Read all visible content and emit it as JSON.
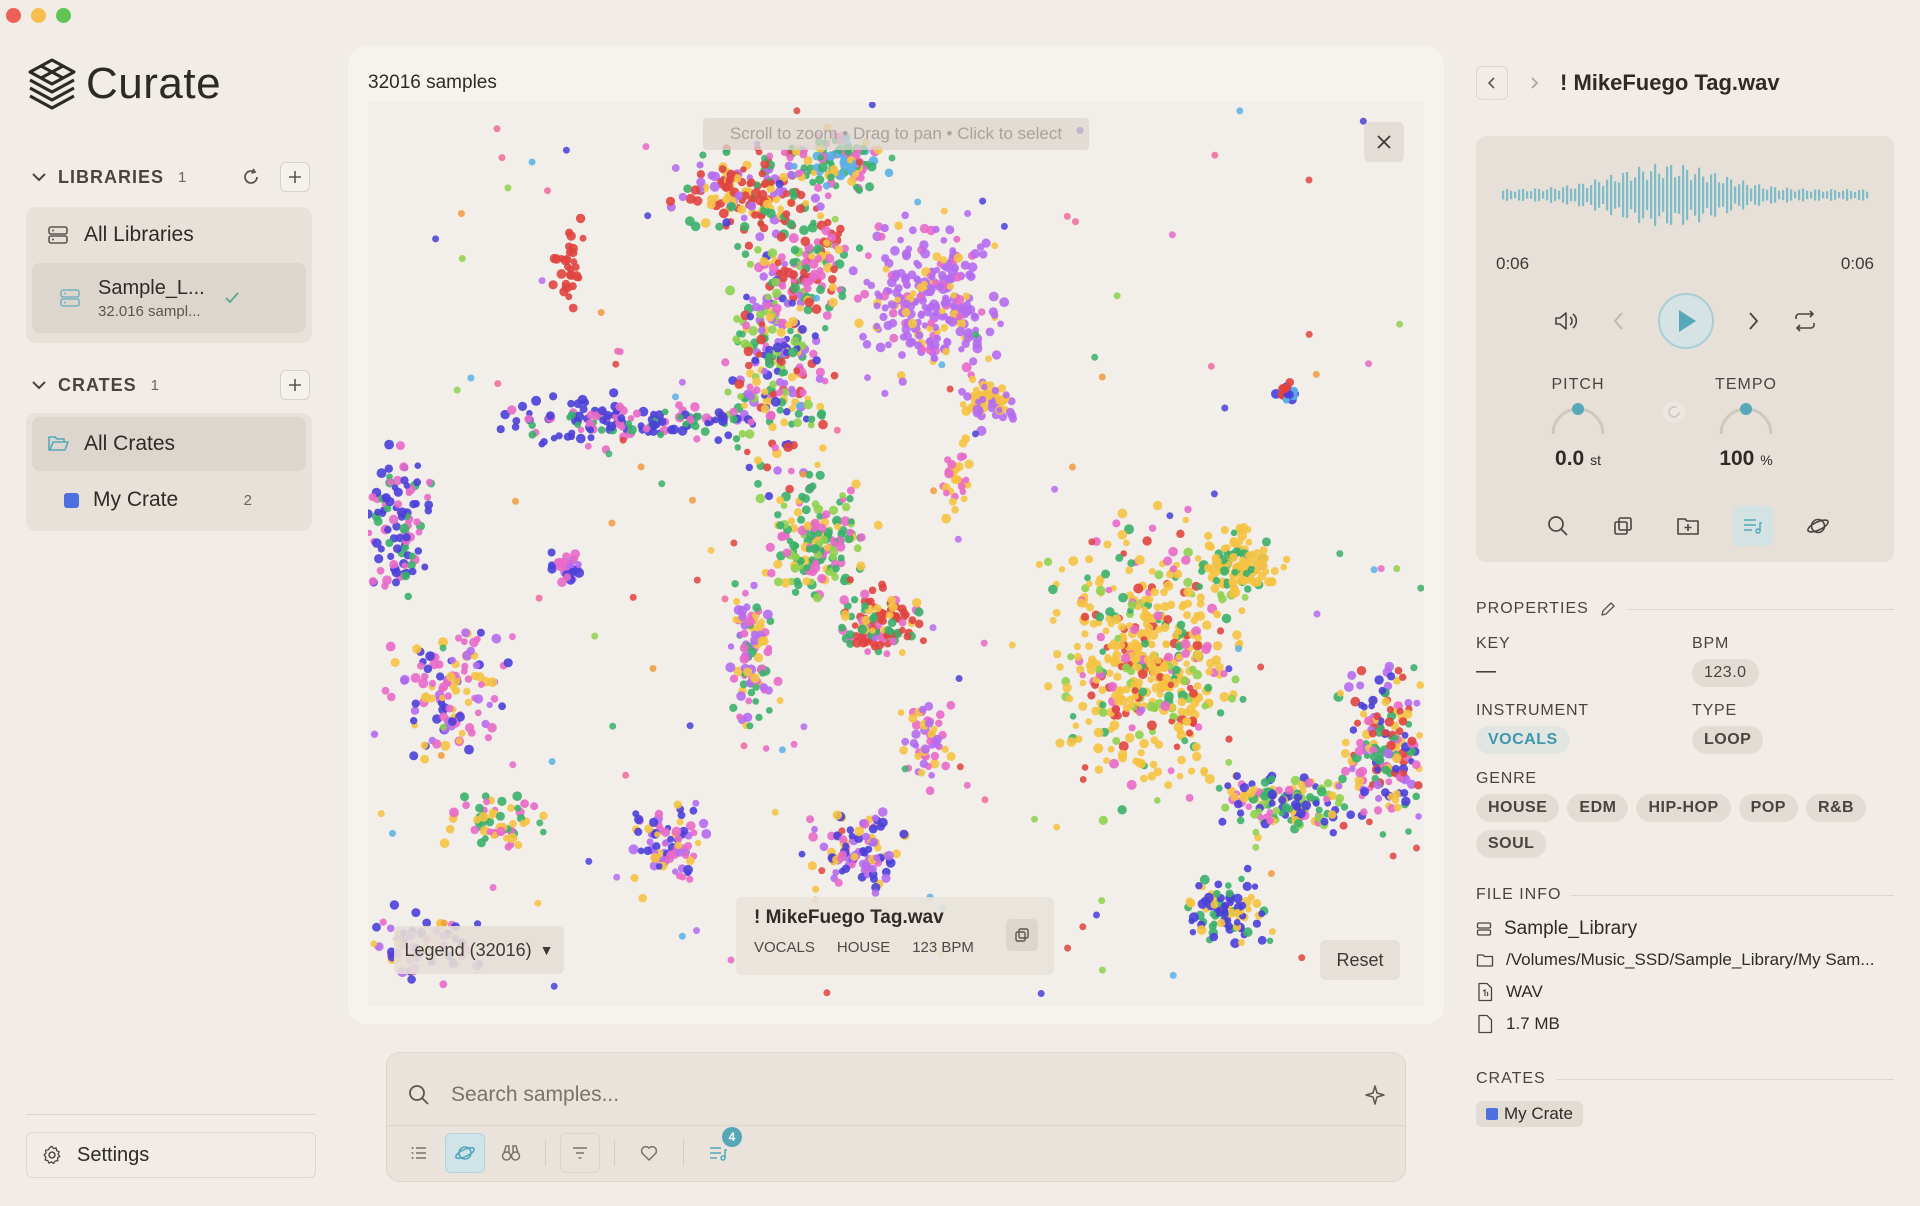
{
  "app": {
    "name": "Curate"
  },
  "sidebar": {
    "libraries": {
      "title": "LIBRARIES",
      "count": "1",
      "all_label": "All Libraries",
      "items": [
        {
          "name": "Sample_L...",
          "sub": "32.016 sampl..."
        }
      ]
    },
    "crates": {
      "title": "CRATES",
      "count": "1",
      "all_label": "All Crates",
      "items": [
        {
          "name": "My Crate",
          "count": "2",
          "color": "#4d6fe0"
        }
      ]
    },
    "settings_label": "Settings"
  },
  "map": {
    "samples_label": "32016 samples",
    "hint": "Scroll to zoom • Drag to pan • Click to select",
    "legend_label": "Legend (32016)",
    "reset_label": "Reset",
    "tooltip": {
      "name": "! MikeFuego Tag.wav",
      "tags": [
        "VOCALS",
        "HOUSE",
        "123 BPM"
      ]
    },
    "palette": [
      "#e0443f",
      "#b56cf0",
      "#f5c243",
      "#4a3fd8",
      "#3bb06a",
      "#e869c8",
      "#5ab0e8",
      "#8fd14f",
      "#f09a3c",
      "#ef6aa0"
    ]
  },
  "search": {
    "placeholder": "Search samples...",
    "queue_badge": "4"
  },
  "detail": {
    "title": "! MikeFuego Tag.wav",
    "time_current": "0:06",
    "time_total": "0:06",
    "pitch": {
      "label": "PITCH",
      "value": "0.0",
      "unit": "st"
    },
    "tempo": {
      "label": "TEMPO",
      "value": "100",
      "unit": "%"
    },
    "properties_label": "PROPERTIES",
    "key_label": "KEY",
    "key_value": "—",
    "bpm_label": "BPM",
    "bpm_value": "123.0",
    "instrument_label": "INSTRUMENT",
    "instrument_value": "VOCALS",
    "type_label": "TYPE",
    "type_value": "LOOP",
    "genre_label": "GENRE",
    "genres": [
      "HOUSE",
      "EDM",
      "HIP-HOP",
      "POP",
      "R&B",
      "SOUL"
    ],
    "file_info_label": "FILE INFO",
    "library": "Sample_Library",
    "path": "/Volumes/Music_SSD/Sample_Library/My Sam...",
    "format": "WAV",
    "size": "1.7 MB",
    "crates_label": "CRATES",
    "crate": "My Crate",
    "accent": "#56a8b9"
  }
}
